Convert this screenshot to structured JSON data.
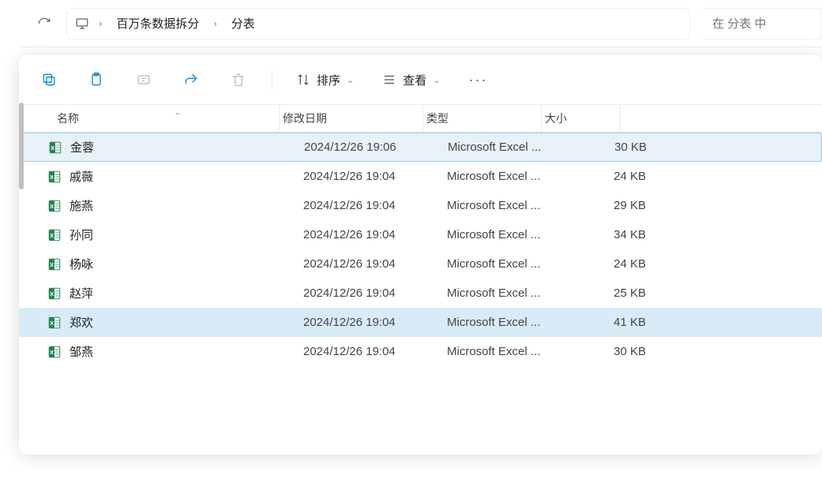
{
  "address": {
    "segments": [
      "百万条数据拆分",
      "分表"
    ]
  },
  "search": {
    "placeholder": "在 分表 中"
  },
  "toolbar": {
    "sort": "排序",
    "view": "查看"
  },
  "columns": {
    "name": "名称",
    "date": "修改日期",
    "type": "类型",
    "size": "大小"
  },
  "rows": [
    {
      "name": "金蓉",
      "date": "2024/12/26 19:06",
      "type": "Microsoft Excel ...",
      "size": "30 KB",
      "state": "selected"
    },
    {
      "name": "戚薇",
      "date": "2024/12/26 19:04",
      "type": "Microsoft Excel ...",
      "size": "24 KB",
      "state": ""
    },
    {
      "name": "施燕",
      "date": "2024/12/26 19:04",
      "type": "Microsoft Excel ...",
      "size": "29 KB",
      "state": ""
    },
    {
      "name": "孙同",
      "date": "2024/12/26 19:04",
      "type": "Microsoft Excel ...",
      "size": "34 KB",
      "state": ""
    },
    {
      "name": "杨咏",
      "date": "2024/12/26 19:04",
      "type": "Microsoft Excel ...",
      "size": "24 KB",
      "state": ""
    },
    {
      "name": "赵萍",
      "date": "2024/12/26 19:04",
      "type": "Microsoft Excel ...",
      "size": "25 KB",
      "state": ""
    },
    {
      "name": "郑欢",
      "date": "2024/12/26 19:04",
      "type": "Microsoft Excel ...",
      "size": "41 KB",
      "state": "hover"
    },
    {
      "name": "邹燕",
      "date": "2024/12/26 19:04",
      "type": "Microsoft Excel ...",
      "size": "30 KB",
      "state": ""
    }
  ]
}
